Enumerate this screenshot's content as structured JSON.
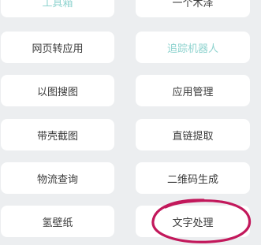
{
  "tools": {
    "left": [
      {
        "label": "工具箱",
        "accent": true
      },
      {
        "label": "网页转应用",
        "accent": false
      },
      {
        "label": "以图搜图",
        "accent": false
      },
      {
        "label": "带壳截图",
        "accent": false
      },
      {
        "label": "物流查询",
        "accent": false
      },
      {
        "label": "氢壁纸",
        "accent": false
      }
    ],
    "right": [
      {
        "label": "一个木泽",
        "accent": false
      },
      {
        "label": "追踪机器人",
        "accent": true
      },
      {
        "label": "应用管理",
        "accent": false
      },
      {
        "label": "直链提取",
        "accent": false
      },
      {
        "label": "二维码生成",
        "accent": false
      },
      {
        "label": "文字处理",
        "accent": false
      }
    ]
  },
  "colors": {
    "background": "#eceef0",
    "tile": "#ffffff",
    "text": "#3a3a3a",
    "accent_text": "#8fd3cf",
    "annotation": "#c2185b"
  }
}
